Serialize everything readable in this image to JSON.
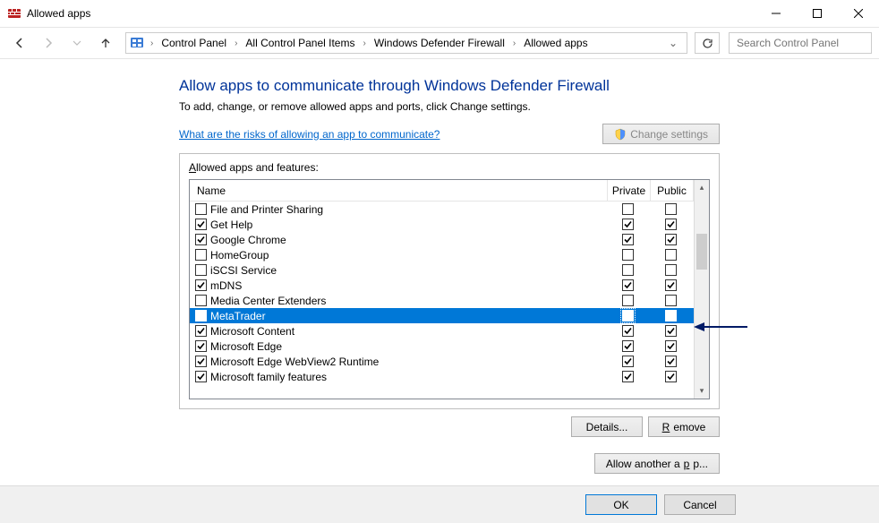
{
  "window": {
    "title": "Allowed apps"
  },
  "nav": {
    "breadcrumb": [
      "Control Panel",
      "All Control Panel Items",
      "Windows Defender Firewall",
      "Allowed apps"
    ],
    "search_placeholder": "Search Control Panel"
  },
  "page": {
    "heading": "Allow apps to communicate through Windows Defender Firewall",
    "sub": "To add, change, or remove allowed apps and ports, click Change settings.",
    "risk_link": "What are the risks of allowing an app to communicate?",
    "change_settings": "Change settings",
    "group_label_prefix": "A",
    "group_label_rest": "llowed apps and features:",
    "cols": {
      "name": "Name",
      "private": "Private",
      "public": "Public"
    },
    "apps": [
      {
        "name": "File and Printer Sharing",
        "enabled": false,
        "private": false,
        "public": false
      },
      {
        "name": "Get Help",
        "enabled": true,
        "private": true,
        "public": true
      },
      {
        "name": "Google Chrome",
        "enabled": true,
        "private": true,
        "public": true
      },
      {
        "name": "HomeGroup",
        "enabled": false,
        "private": false,
        "public": false
      },
      {
        "name": "iSCSI Service",
        "enabled": false,
        "private": false,
        "public": false
      },
      {
        "name": "mDNS",
        "enabled": true,
        "private": true,
        "public": true
      },
      {
        "name": "Media Center Extenders",
        "enabled": false,
        "private": false,
        "public": false
      },
      {
        "name": "MetaTrader",
        "enabled": true,
        "private": true,
        "public": true,
        "selected": true
      },
      {
        "name": "Microsoft Content",
        "enabled": true,
        "private": true,
        "public": true
      },
      {
        "name": "Microsoft Edge",
        "enabled": true,
        "private": true,
        "public": true
      },
      {
        "name": "Microsoft Edge WebView2 Runtime",
        "enabled": true,
        "private": true,
        "public": true
      },
      {
        "name": "Microsoft family features",
        "enabled": true,
        "private": true,
        "public": true
      }
    ],
    "buttons": {
      "details": "Details...",
      "remove": "Remove",
      "allow_another": "Allow another app...",
      "ok": "OK",
      "cancel": "Cancel"
    }
  }
}
